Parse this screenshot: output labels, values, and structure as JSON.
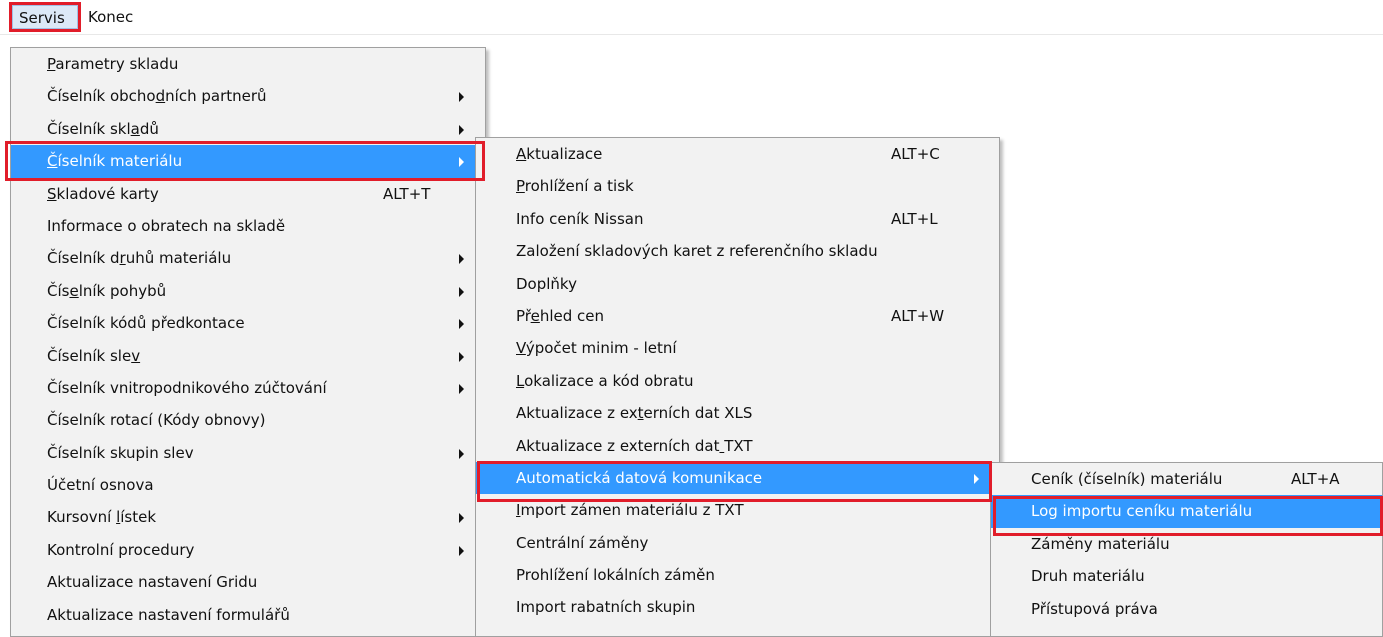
{
  "menubar": {
    "items": [
      {
        "label": "Servis",
        "active": true
      },
      {
        "label": "Konec",
        "active": false
      }
    ]
  },
  "menu1": {
    "items": [
      {
        "label": "Parametry skladu",
        "mn": 0,
        "shortcut": "",
        "submenu": false
      },
      {
        "label": "Číselník obchodních partnerů",
        "mn": 14,
        "shortcut": "",
        "submenu": true
      },
      {
        "label": "Číselník skladů",
        "mn": 12,
        "shortcut": "",
        "submenu": true
      },
      {
        "label": "Číselník materiálu",
        "mn": 0,
        "shortcut": "",
        "submenu": true,
        "highlight": true
      },
      {
        "label": "Skladové karty",
        "mn": 0,
        "shortcut": "ALT+T",
        "submenu": false
      },
      {
        "label": "Informace o obratech na skladě",
        "mn": -1,
        "shortcut": "",
        "submenu": false
      },
      {
        "label": "Číselník druhů materiálu",
        "mn": 10,
        "shortcut": "",
        "submenu": true
      },
      {
        "label": "Číselník pohybů",
        "mn": 3,
        "shortcut": "",
        "submenu": true
      },
      {
        "label": "Číselník kódů předkontace",
        "mn": -1,
        "shortcut": "",
        "submenu": true
      },
      {
        "label": "Číselník slev",
        "mn": 12,
        "shortcut": "",
        "submenu": true
      },
      {
        "label": "Číselník vnitropodnikového zúčtování",
        "mn": -1,
        "shortcut": "",
        "submenu": true
      },
      {
        "label": "Číselník rotací (Kódy obnovy)",
        "mn": -1,
        "shortcut": "",
        "submenu": false
      },
      {
        "label": "Číselník skupin slev",
        "mn": -1,
        "shortcut": "",
        "submenu": true
      },
      {
        "label": "Účetní osnova",
        "mn": -1,
        "shortcut": "",
        "submenu": false
      },
      {
        "label": "Kursovní lístek",
        "mn": 9,
        "shortcut": "",
        "submenu": true
      },
      {
        "label": "Kontrolní procedury",
        "mn": -1,
        "shortcut": "",
        "submenu": true
      },
      {
        "label": "Aktualizace nastavení Gridu",
        "mn": -1,
        "shortcut": "",
        "submenu": false
      },
      {
        "label": "Aktualizace nastavení formulářů",
        "mn": -1,
        "shortcut": "",
        "submenu": false
      }
    ]
  },
  "menu2": {
    "items": [
      {
        "label": "Aktualizace",
        "mn": 0,
        "shortcut": "ALT+C",
        "submenu": false
      },
      {
        "label": "Prohlížení a tisk",
        "mn": 0,
        "shortcut": "",
        "submenu": false
      },
      {
        "label": "Info ceník Nissan",
        "mn": -1,
        "shortcut": "ALT+L",
        "submenu": false
      },
      {
        "label": "Založení skladových karet z referenčního skladu",
        "mn": -1,
        "shortcut": "",
        "submenu": false
      },
      {
        "label": "Doplňky",
        "mn": -1,
        "shortcut": "",
        "submenu": false
      },
      {
        "label": "Přehled cen",
        "mn": 2,
        "shortcut": "ALT+W",
        "submenu": false
      },
      {
        "label": "Výpočet minim - letní",
        "mn": 0,
        "shortcut": "",
        "submenu": false
      },
      {
        "label": "Lokalizace a kód obratu",
        "mn": 0,
        "shortcut": "",
        "submenu": false
      },
      {
        "label": "Aktualizace z externích dat XLS",
        "mn": 16,
        "shortcut": "",
        "submenu": false
      },
      {
        "label": "Aktualizace z externích dat TXT",
        "mn": 27,
        "shortcut": "",
        "submenu": false
      },
      {
        "label": "Automatická datová komunikace",
        "mn": -1,
        "shortcut": "",
        "submenu": true,
        "highlight": true
      },
      {
        "label": "Import zámen materiálu z TXT",
        "mn": 0,
        "shortcut": "",
        "submenu": false
      },
      {
        "label": "Centrální záměny",
        "mn": -1,
        "shortcut": "",
        "submenu": false
      },
      {
        "label": "Prohlížení lokálních záměn",
        "mn": -1,
        "shortcut": "",
        "submenu": false
      },
      {
        "label": "Import rabatních skupin",
        "mn": -1,
        "shortcut": "",
        "submenu": false
      }
    ]
  },
  "menu3": {
    "items": [
      {
        "label": "Ceník (číselník) materiálu",
        "mn": -1,
        "shortcut": "ALT+A",
        "submenu": false
      },
      {
        "label": "Log importu ceníku materiálu",
        "mn": -1,
        "shortcut": "",
        "submenu": false,
        "highlight": true
      },
      {
        "label": "Záměny materiálu",
        "mn": -1,
        "shortcut": "",
        "submenu": false
      },
      {
        "label": "Druh materiálu",
        "mn": -1,
        "shortcut": "",
        "submenu": false
      },
      {
        "label": "Přístupová práva",
        "mn": -1,
        "shortcut": "",
        "submenu": false
      }
    ]
  },
  "colors": {
    "highlight": "#3399ff",
    "annotation": "#e11d2a",
    "menu_bg": "#f2f2f2"
  }
}
